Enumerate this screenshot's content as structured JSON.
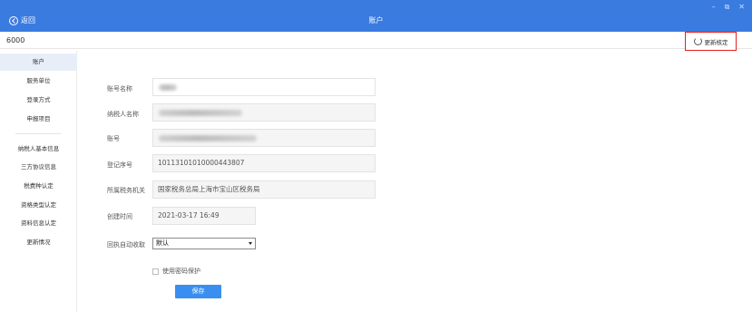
{
  "titlebar": {
    "back_label": "返回",
    "title": "账户",
    "controls": [
      "–",
      "⧉",
      "✕"
    ]
  },
  "subheader": {
    "tax_id": "6000",
    "update_label": "更新核定"
  },
  "sidebar": {
    "items": [
      {
        "label": "账户",
        "active": true
      },
      {
        "label": "服务单位"
      },
      {
        "label": "登录方式"
      },
      {
        "label": "申报项目"
      },
      {
        "label": "纳税人基本信息"
      },
      {
        "label": "三方协议信息"
      },
      {
        "label": "税费种认定"
      },
      {
        "label": "资格类型认定"
      },
      {
        "label": "资料信息认定"
      },
      {
        "label": "更新情况"
      }
    ]
  },
  "form": {
    "account_name_label": "账号名称",
    "taxpayer_name_label": "纳税人名称",
    "account_label": "账号",
    "reg_no_label": "登记序号",
    "reg_no_value": "10113101010000443807",
    "tax_office_label": "所属税务机关",
    "tax_office_value": "国家税务总局上海市宝山区税务局",
    "created_label": "创建时间",
    "created_value": "2021-03-17 16:49",
    "auto_receive_label": "回执自动收取",
    "auto_receive_value": "默认",
    "password_protect_label": "使用密码保护",
    "save_label": "保存"
  }
}
